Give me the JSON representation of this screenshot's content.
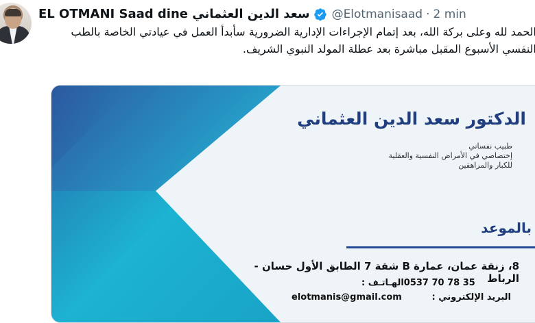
{
  "tweet": {
    "name": "EL OTMANI Saad dine سعد الدين العثماني",
    "handle": "@Elotmanisaad",
    "separator": "·",
    "time": "2 min",
    "text": "الحمد لله وعلى بركة الله، بعد إتمام الإجراءات الإدارية الضرورية سأبدأ العمل في عيادتي الخاصة بالطب النفسي الأسبوع المقبل مباشرة بعد عطلة المولد النبوي الشريف."
  },
  "card": {
    "title": "الدكتور سعد الدين العثماني",
    "lines": [
      "طبيب نفساني",
      "إختصاصي في الأمراض النفسية والعقلية",
      "للكبار والمراهقين"
    ],
    "appointment": "بالموعد",
    "address": "8، زنقة عمان، عمارة B شقة 7 الطابق الأول حسان - الرباط",
    "email_label": "البريد الإلكتروني :",
    "email_value": "elotmanis@gmail.com",
    "phone_label": "الهـاتـف :",
    "phone_value": "0537 70 78 35"
  },
  "icons": {
    "verified": "verified-badge-icon"
  },
  "colors": {
    "verified": "#1d9bf0",
    "card_blue": "#244795",
    "card_teal": "#18a7c8"
  }
}
